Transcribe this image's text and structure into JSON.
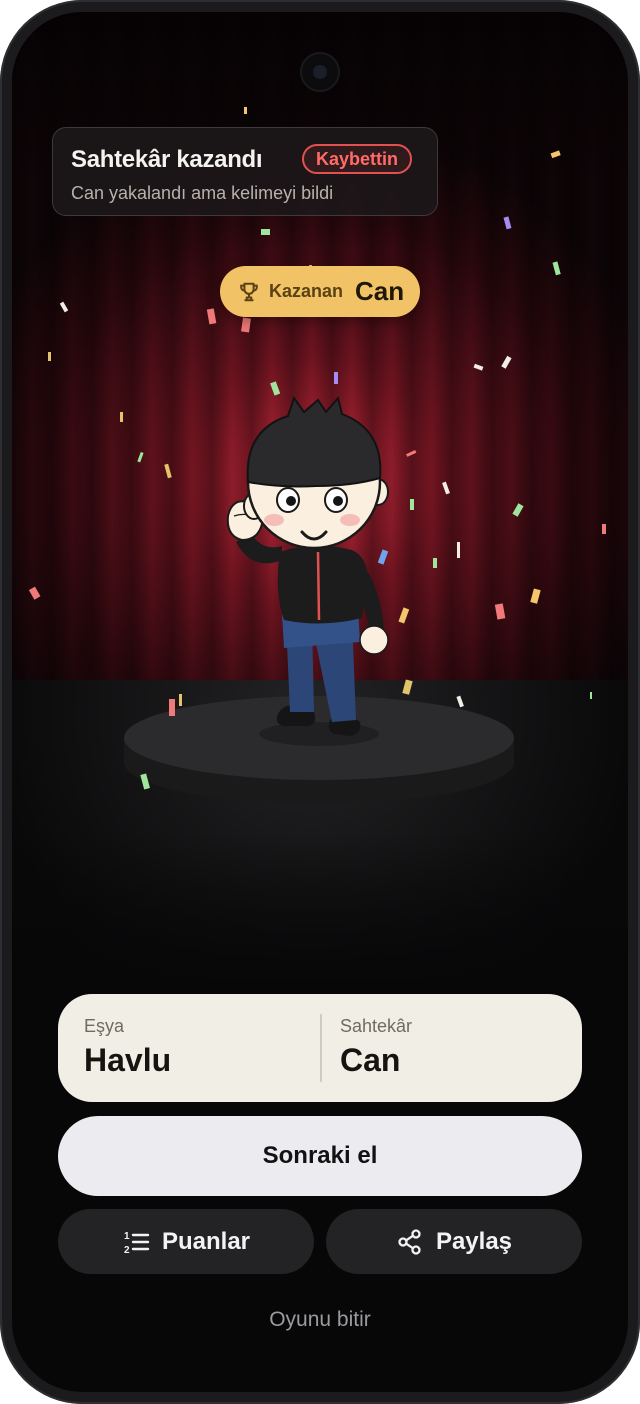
{
  "result": {
    "title": "Sahtekâr kazandı",
    "badge": "Kaybettin",
    "subtitle": "Can yakalandı ama kelimeyi bildi"
  },
  "winner": {
    "label": "Kazanan",
    "name": "Can",
    "icon": "trophy-icon"
  },
  "info": {
    "item_label": "Eşya",
    "item_value": "Havlu",
    "impostor_label": "Sahtekâr",
    "impostor_value": "Can"
  },
  "actions": {
    "next_round": "Sonraki el",
    "scores": "Puanlar",
    "scores_icon": "numbered-list-icon",
    "share": "Paylaş",
    "share_icon": "share-icon",
    "end_game": "Oyunu bitir"
  },
  "colors": {
    "accent_gold": "#f2c266",
    "lost_red": "#e2514f",
    "card_cream": "#f1eee6",
    "button_light": "#ecebef",
    "button_dark": "#232326"
  }
}
